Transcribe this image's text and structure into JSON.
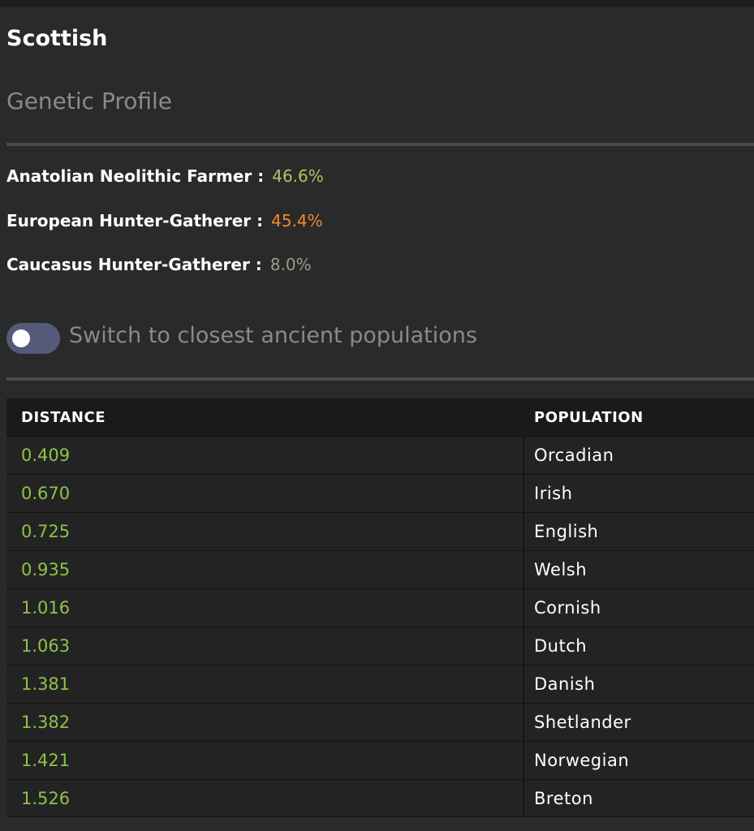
{
  "title": "Scottish",
  "subtitle": "Genetic Profile",
  "stats": [
    {
      "label": "Anatolian Neolithic Farmer :",
      "value": "46.6%",
      "color": "#a8c96a"
    },
    {
      "label": "European Hunter-Gatherer :",
      "value": "45.4%",
      "color": "#f08a2c"
    },
    {
      "label": "Caucasus Hunter-Gatherer :",
      "value": "8.0%",
      "color": "#9a9a8a"
    }
  ],
  "toggle": {
    "label": "Switch to closest ancient populations",
    "on": false
  },
  "table": {
    "headers": {
      "distance": "DISTANCE",
      "population": "POPULATION"
    },
    "rows": [
      {
        "distance": "0.409",
        "population": "Orcadian"
      },
      {
        "distance": "0.670",
        "population": "Irish"
      },
      {
        "distance": "0.725",
        "population": "English"
      },
      {
        "distance": "0.935",
        "population": "Welsh"
      },
      {
        "distance": "1.016",
        "population": "Cornish"
      },
      {
        "distance": "1.063",
        "population": "Dutch"
      },
      {
        "distance": "1.381",
        "population": "Danish"
      },
      {
        "distance": "1.382",
        "population": "Shetlander"
      },
      {
        "distance": "1.421",
        "population": "Norwegian"
      },
      {
        "distance": "1.526",
        "population": "Breton"
      }
    ]
  },
  "colors": {
    "distance_value": "#8bc34a",
    "toggle_track": "#545a78"
  }
}
